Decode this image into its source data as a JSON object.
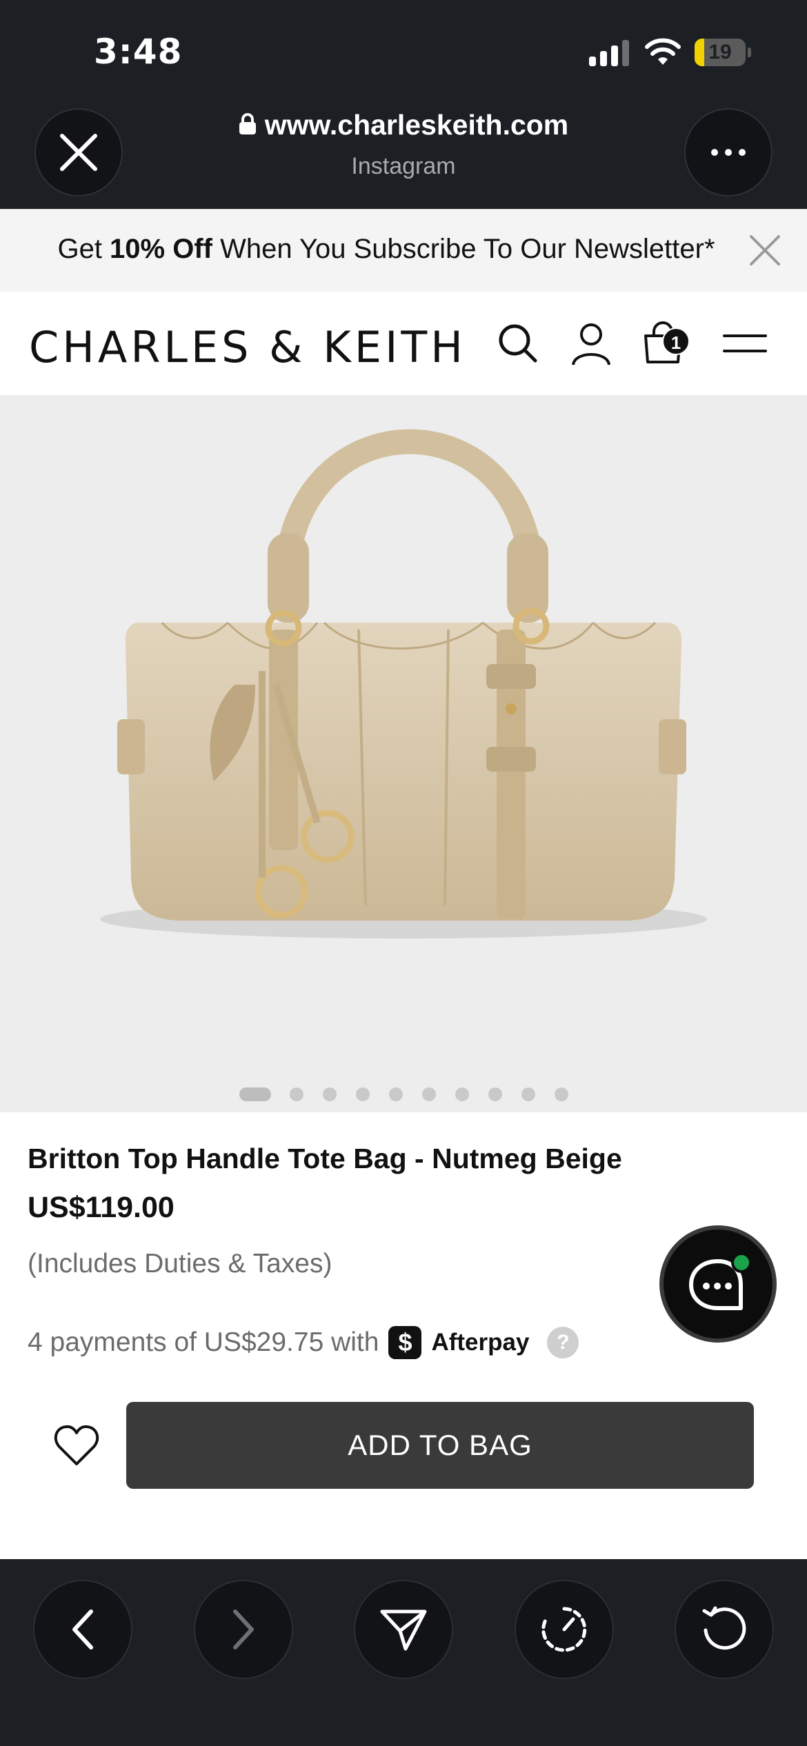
{
  "status_bar": {
    "time": "3:48",
    "battery": "19",
    "battery_level": 0.19
  },
  "browser": {
    "url": "www.charleskeith.com",
    "subtitle": "Instagram"
  },
  "promo": {
    "prefix": "Get ",
    "highlight": "10% Off",
    "suffix": " When You Subscribe To Our Newsletter*"
  },
  "header": {
    "logo": "CHARLES & KEITH",
    "cart_count": "1"
  },
  "gallery": {
    "image_count": 10,
    "active_index": 0
  },
  "product": {
    "name": "Britton Top Handle Tote Bag - Nutmeg Beige",
    "price": "US$119.00",
    "duties_note": "(Includes Duties & Taxes)",
    "installments_text": "4 payments of US$29.75 with",
    "afterpay_logo": "$",
    "afterpay_name": "Afterpay",
    "afterpay_help": "?",
    "add_to_bag_label": "ADD TO BAG"
  },
  "icons": {
    "close": "close-icon",
    "more": "more-icon",
    "lock": "lock-icon",
    "search": "search-icon",
    "account": "user-icon",
    "bag": "shopping-bag-icon",
    "menu": "hamburger-menu-icon",
    "chat": "chat-icon",
    "wishlist": "heart-icon",
    "back": "chevron-left-icon",
    "forward": "chevron-right-icon",
    "share": "send-icon",
    "speed": "gauge-icon",
    "reload": "reload-icon"
  },
  "colors": {
    "chrome_bg": "#1c1f24",
    "button_dark": "#3a3a3a",
    "battery_yellow": "#f2d300",
    "chat_online": "#1aa34a",
    "bag_beige": "#d9c8aa"
  }
}
